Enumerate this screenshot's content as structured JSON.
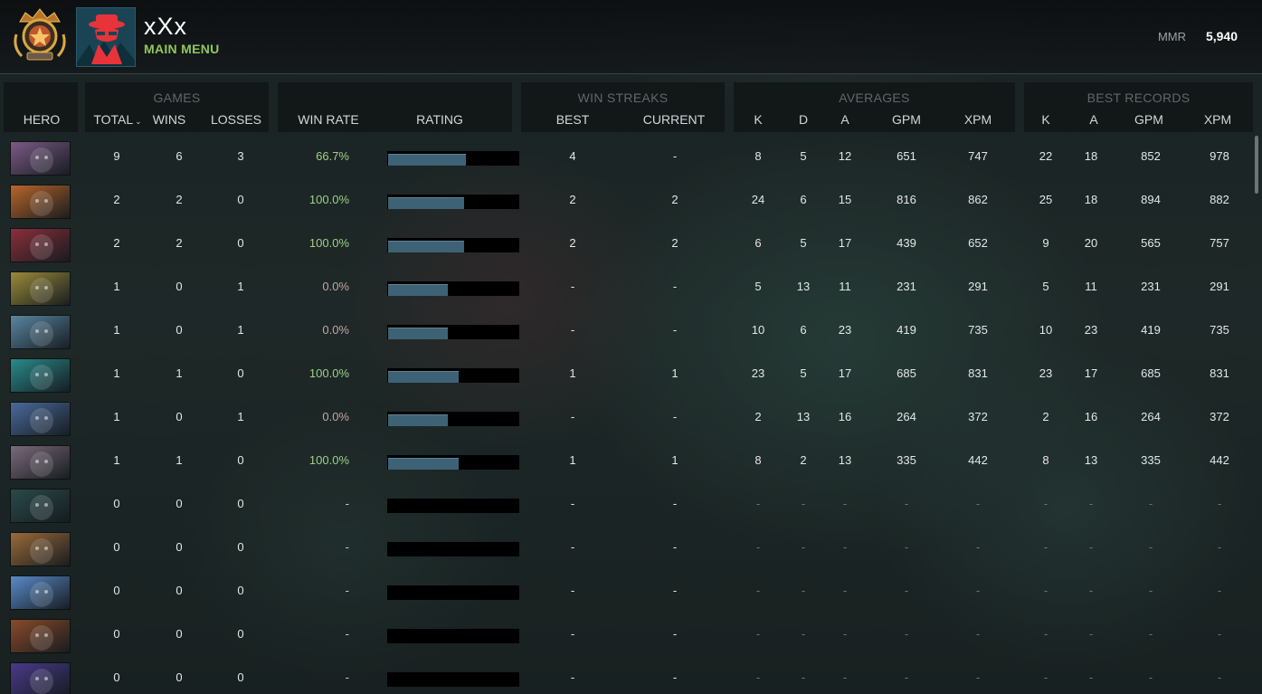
{
  "header": {
    "player_name": "xXx",
    "main_menu_label": "MAIN MENU",
    "mmr_label": "MMR",
    "mmr_value": "5,940"
  },
  "columns": {
    "hero": "HERO",
    "games_group": "GAMES",
    "total": "TOTAL",
    "wins": "WINS",
    "losses": "LOSSES",
    "win_rate": "WIN RATE",
    "rating": "RATING",
    "win_streaks_group": "WIN STREAKS",
    "best": "BEST",
    "current": "CURRENT",
    "averages_group": "AVERAGES",
    "avg_k": "K",
    "avg_d": "D",
    "avg_a": "A",
    "avg_gpm": "GPM",
    "avg_xpm": "XPM",
    "best_records_group": "BEST RECORDS",
    "rec_k": "K",
    "rec_a": "A",
    "rec_gpm": "GPM",
    "rec_xpm": "XPM"
  },
  "colors": {
    "portraits": [
      "#7b5a86",
      "#b8652a",
      "#8a2f3a",
      "#9a8a3a",
      "#5a86a0",
      "#2a8a8a",
      "#4a6a9a",
      "#7a6a7a",
      "#2a4a4a",
      "#9a6a3a",
      "#5a8ac8",
      "#8a4a2a",
      "#4a3a8a"
    ]
  },
  "rows": [
    {
      "total": "9",
      "wins": "6",
      "losses": "3",
      "win_rate": "66.7%",
      "rating": 0.6,
      "best": "4",
      "current": "-",
      "k": "8",
      "d": "5",
      "a": "12",
      "gpm": "651",
      "xpm": "747",
      "rk": "22",
      "ra": "18",
      "rgpm": "852",
      "rxpm": "978"
    },
    {
      "total": "2",
      "wins": "2",
      "losses": "0",
      "win_rate": "100.0%",
      "rating": 0.58,
      "best": "2",
      "current": "2",
      "k": "24",
      "d": "6",
      "a": "15",
      "gpm": "816",
      "xpm": "862",
      "rk": "25",
      "ra": "18",
      "rgpm": "894",
      "rxpm": "882"
    },
    {
      "total": "2",
      "wins": "2",
      "losses": "0",
      "win_rate": "100.0%",
      "rating": 0.58,
      "best": "2",
      "current": "2",
      "k": "6",
      "d": "5",
      "a": "17",
      "gpm": "439",
      "xpm": "652",
      "rk": "9",
      "ra": "20",
      "rgpm": "565",
      "rxpm": "757"
    },
    {
      "total": "1",
      "wins": "0",
      "losses": "1",
      "win_rate": "0.0%",
      "rating": 0.46,
      "best": "-",
      "current": "-",
      "k": "5",
      "d": "13",
      "a": "11",
      "gpm": "231",
      "xpm": "291",
      "rk": "5",
      "ra": "11",
      "rgpm": "231",
      "rxpm": "291"
    },
    {
      "total": "1",
      "wins": "0",
      "losses": "1",
      "win_rate": "0.0%",
      "rating": 0.46,
      "best": "-",
      "current": "-",
      "k": "10",
      "d": "6",
      "a": "23",
      "gpm": "419",
      "xpm": "735",
      "rk": "10",
      "ra": "23",
      "rgpm": "419",
      "rxpm": "735"
    },
    {
      "total": "1",
      "wins": "1",
      "losses": "0",
      "win_rate": "100.0%",
      "rating": 0.54,
      "best": "1",
      "current": "1",
      "k": "23",
      "d": "5",
      "a": "17",
      "gpm": "685",
      "xpm": "831",
      "rk": "23",
      "ra": "17",
      "rgpm": "685",
      "rxpm": "831"
    },
    {
      "total": "1",
      "wins": "0",
      "losses": "1",
      "win_rate": "0.0%",
      "rating": 0.46,
      "best": "-",
      "current": "-",
      "k": "2",
      "d": "13",
      "a": "16",
      "gpm": "264",
      "xpm": "372",
      "rk": "2",
      "ra": "16",
      "rgpm": "264",
      "rxpm": "372"
    },
    {
      "total": "1",
      "wins": "1",
      "losses": "0",
      "win_rate": "100.0%",
      "rating": 0.54,
      "best": "1",
      "current": "1",
      "k": "8",
      "d": "2",
      "a": "13",
      "gpm": "335",
      "xpm": "442",
      "rk": "8",
      "ra": "13",
      "rgpm": "335",
      "rxpm": "442"
    },
    {
      "total": "0",
      "wins": "0",
      "losses": "0",
      "win_rate": "-",
      "rating": 0,
      "best": "-",
      "current": "-",
      "k": "-",
      "d": "-",
      "a": "-",
      "gpm": "-",
      "xpm": "-",
      "rk": "-",
      "ra": "-",
      "rgpm": "-",
      "rxpm": "-"
    },
    {
      "total": "0",
      "wins": "0",
      "losses": "0",
      "win_rate": "-",
      "rating": 0,
      "best": "-",
      "current": "-",
      "k": "-",
      "d": "-",
      "a": "-",
      "gpm": "-",
      "xpm": "-",
      "rk": "-",
      "ra": "-",
      "rgpm": "-",
      "rxpm": "-"
    },
    {
      "total": "0",
      "wins": "0",
      "losses": "0",
      "win_rate": "-",
      "rating": 0,
      "best": "-",
      "current": "-",
      "k": "-",
      "d": "-",
      "a": "-",
      "gpm": "-",
      "xpm": "-",
      "rk": "-",
      "ra": "-",
      "rgpm": "-",
      "rxpm": "-"
    },
    {
      "total": "0",
      "wins": "0",
      "losses": "0",
      "win_rate": "-",
      "rating": 0,
      "best": "-",
      "current": "-",
      "k": "-",
      "d": "-",
      "a": "-",
      "gpm": "-",
      "xpm": "-",
      "rk": "-",
      "ra": "-",
      "rgpm": "-",
      "rxpm": "-"
    },
    {
      "total": "0",
      "wins": "0",
      "losses": "0",
      "win_rate": "-",
      "rating": 0,
      "best": "-",
      "current": "-",
      "k": "-",
      "d": "-",
      "a": "-",
      "gpm": "-",
      "xpm": "-",
      "rk": "-",
      "ra": "-",
      "rgpm": "-",
      "rxpm": "-"
    }
  ]
}
